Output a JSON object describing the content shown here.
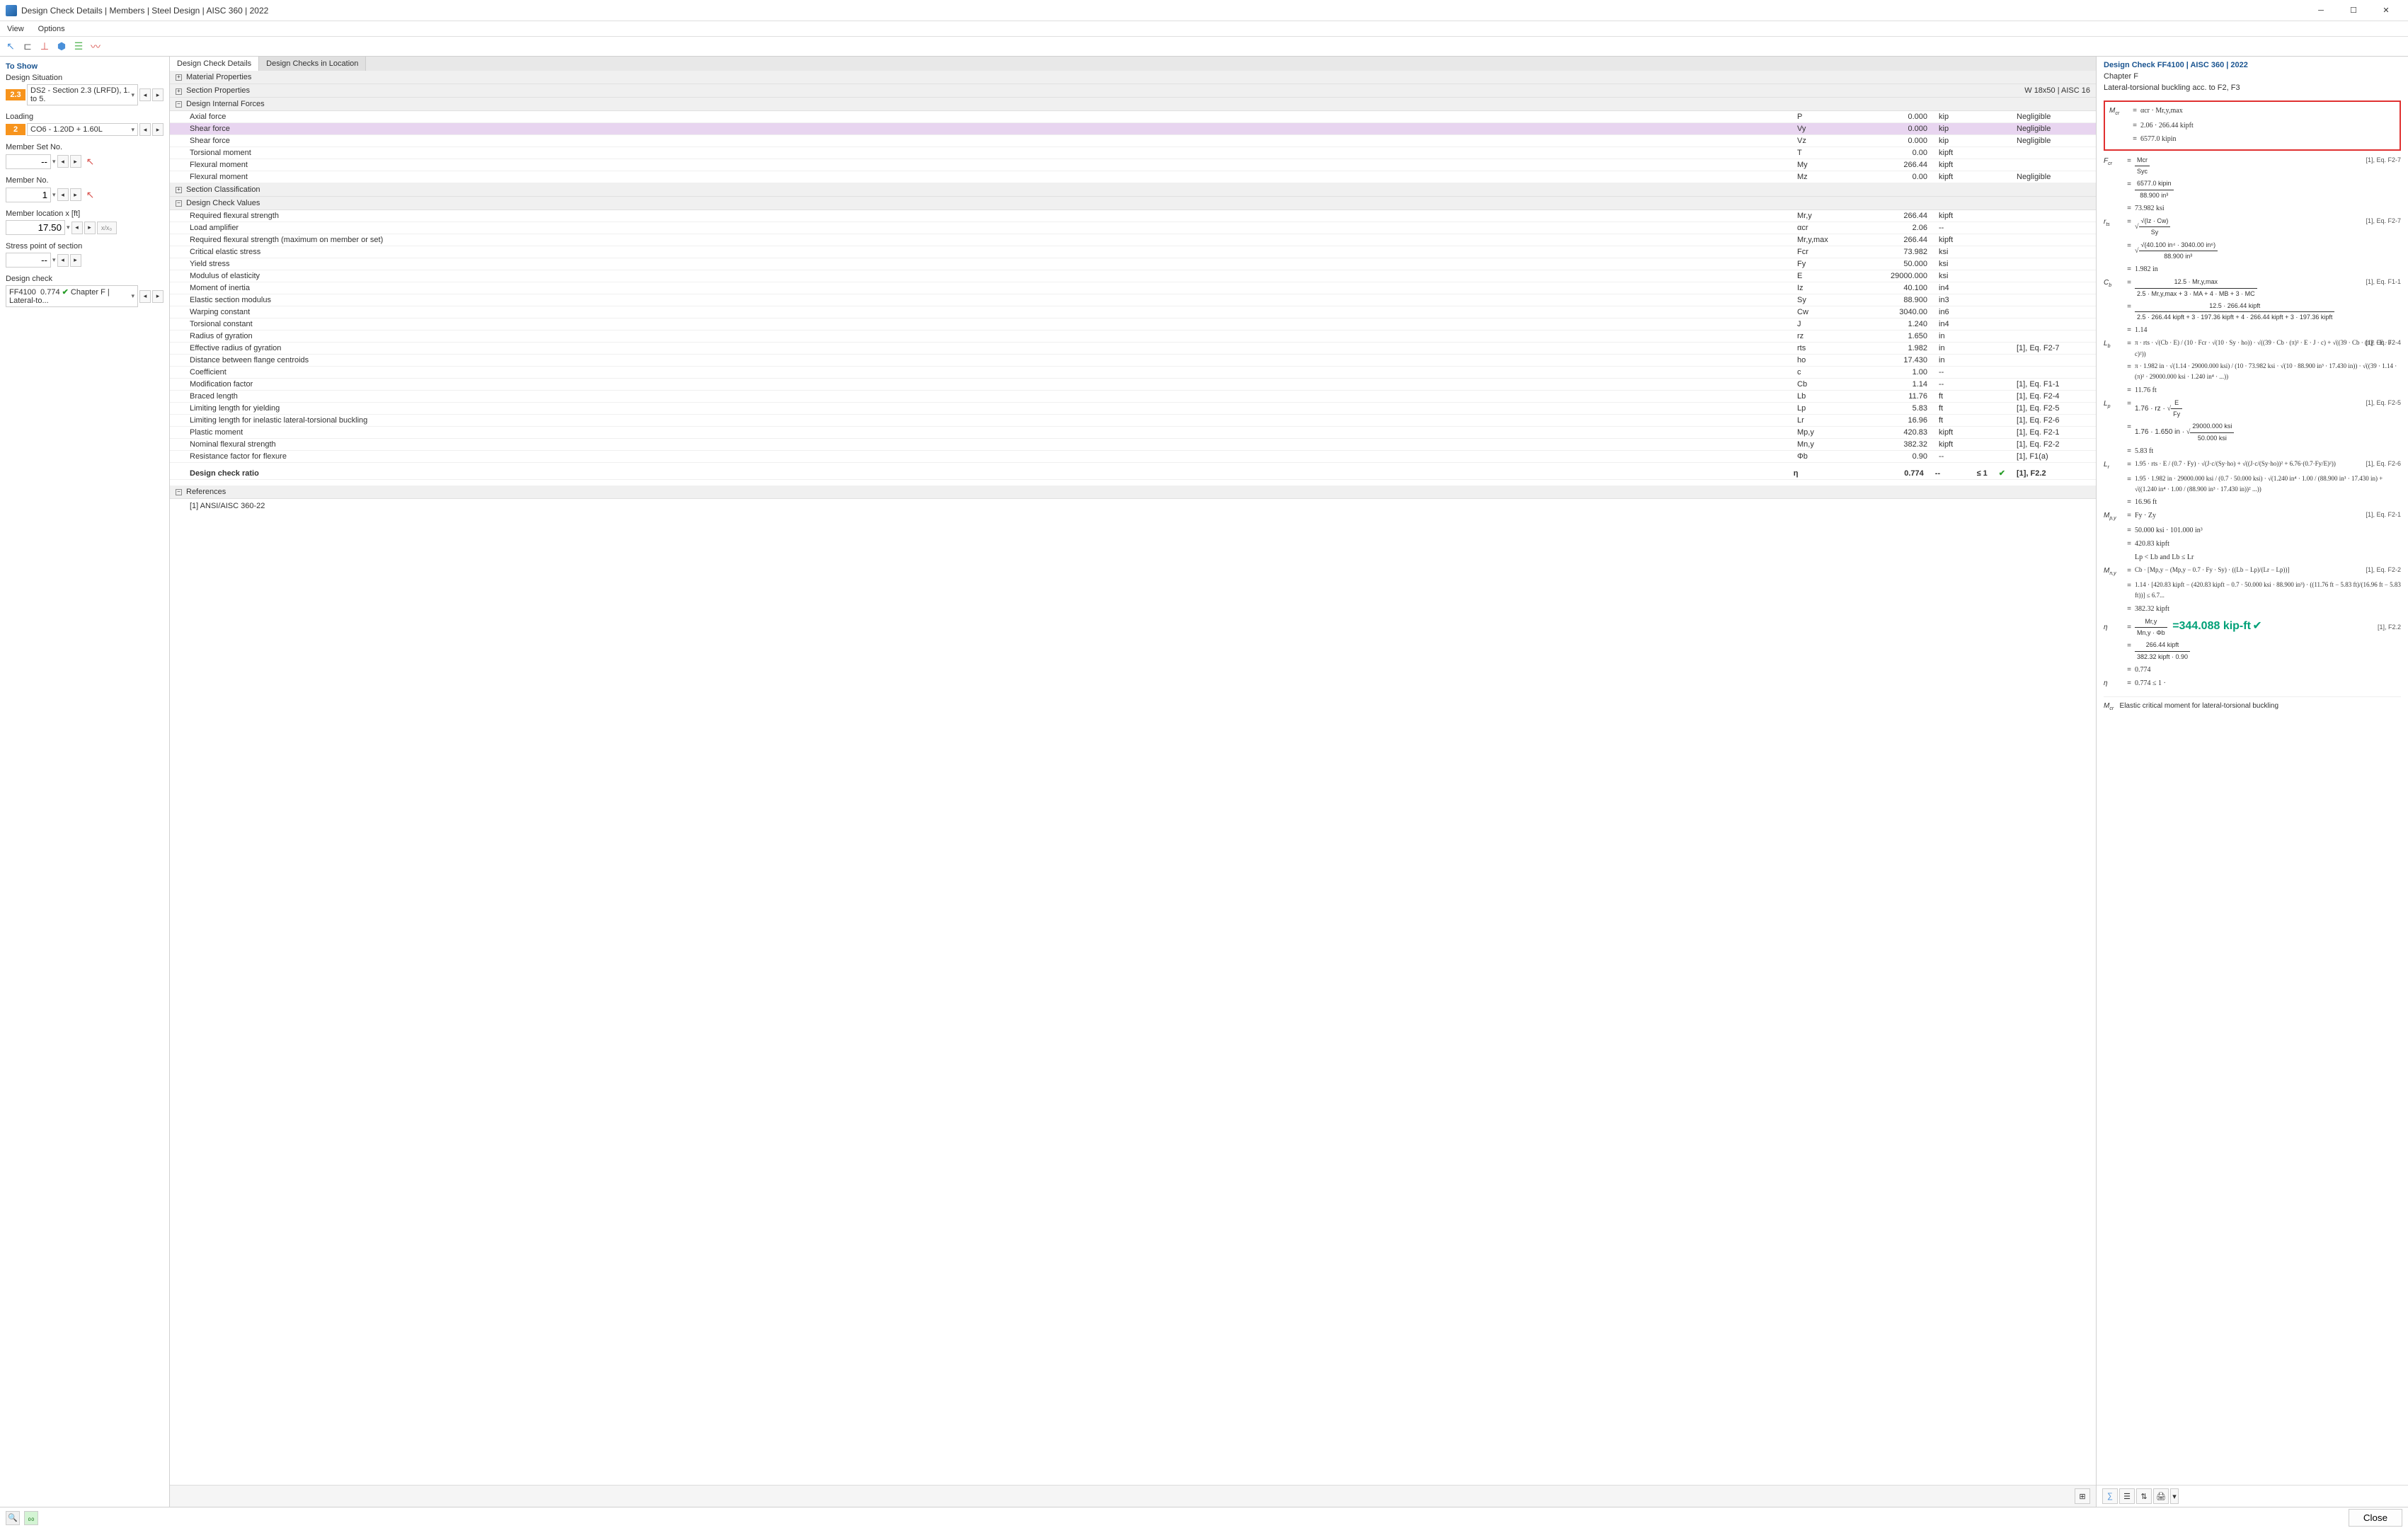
{
  "window": {
    "title": "Design Check Details | Members | Steel Design | AISC 360 | 2022"
  },
  "menu": {
    "view": "View",
    "options": "Options"
  },
  "leftPanel": {
    "header": "To Show",
    "designSituation": {
      "label": "Design Situation",
      "badge": "2.3",
      "value": "DS2 - Section 2.3 (LRFD), 1. to 5."
    },
    "loading": {
      "label": "Loading",
      "badge": "2",
      "value": "CO6 - 1.20D + 1.60L"
    },
    "memberSet": {
      "label": "Member Set No.",
      "value": "--"
    },
    "memberNo": {
      "label": "Member No.",
      "value": "1"
    },
    "memberLocation": {
      "label": "Member location x [ft]",
      "value": "17.50",
      "extra": "x/x₀"
    },
    "stressPoint": {
      "label": "Stress point of section",
      "value": "--"
    },
    "designCheck": {
      "label": "Design check",
      "code": "FF4100",
      "ratio": "0.774",
      "desc": "Chapter F | Lateral-to..."
    }
  },
  "centerPanel": {
    "tabs": {
      "tab1": "Design Check Details",
      "tab2": "Design Checks in Location"
    },
    "sections": {
      "matProps": "Material Properties",
      "sectProps": "Section Properties",
      "sectBadge": "W 18x50 | AISC 16",
      "internalForces": "Design Internal Forces",
      "sectClass": "Section Classification",
      "checkValues": "Design Check Values",
      "references": "References"
    },
    "internalForces": [
      {
        "name": "Axial force",
        "sym": "P",
        "val": "0.000",
        "unit": "kip",
        "ref": "Negligible"
      },
      {
        "name": "Shear force",
        "sym": "Vy",
        "val": "0.000",
        "unit": "kip",
        "ref": "Negligible",
        "hl": true
      },
      {
        "name": "Shear force",
        "sym": "Vz",
        "val": "0.000",
        "unit": "kip",
        "ref": "Negligible"
      },
      {
        "name": "Torsional moment",
        "sym": "T",
        "val": "0.00",
        "unit": "kipft",
        "ref": ""
      },
      {
        "name": "Flexural moment",
        "sym": "My",
        "val": "266.44",
        "unit": "kipft",
        "ref": ""
      },
      {
        "name": "Flexural moment",
        "sym": "Mz",
        "val": "0.00",
        "unit": "kipft",
        "ref": "Negligible"
      }
    ],
    "checkValues": [
      {
        "name": "Required flexural strength",
        "sym": "Mr,y",
        "val": "266.44",
        "unit": "kipft",
        "ref": ""
      },
      {
        "name": "Load amplifier",
        "sym": "αcr",
        "val": "2.06",
        "unit": "--",
        "ref": ""
      },
      {
        "name": "Required flexural strength (maximum on member or set)",
        "sym": "Mr,y,max",
        "val": "266.44",
        "unit": "kipft",
        "ref": ""
      },
      {
        "name": "Critical elastic stress",
        "sym": "Fcr",
        "val": "73.982",
        "unit": "ksi",
        "ref": ""
      },
      {
        "name": "Yield stress",
        "sym": "Fy",
        "val": "50.000",
        "unit": "ksi",
        "ref": ""
      },
      {
        "name": "Modulus of elasticity",
        "sym": "E",
        "val": "29000.000",
        "unit": "ksi",
        "ref": ""
      },
      {
        "name": "Moment of inertia",
        "sym": "Iz",
        "val": "40.100",
        "unit": "in4",
        "ref": ""
      },
      {
        "name": "Elastic section modulus",
        "sym": "Sy",
        "val": "88.900",
        "unit": "in3",
        "ref": ""
      },
      {
        "name": "Warping constant",
        "sym": "Cw",
        "val": "3040.00",
        "unit": "in6",
        "ref": ""
      },
      {
        "name": "Torsional constant",
        "sym": "J",
        "val": "1.240",
        "unit": "in4",
        "ref": ""
      },
      {
        "name": "Radius of gyration",
        "sym": "rz",
        "val": "1.650",
        "unit": "in",
        "ref": ""
      },
      {
        "name": "Effective radius of gyration",
        "sym": "rts",
        "val": "1.982",
        "unit": "in",
        "ref": "[1], Eq. F2-7"
      },
      {
        "name": "Distance between flange centroids",
        "sym": "ho",
        "val": "17.430",
        "unit": "in",
        "ref": ""
      },
      {
        "name": "Coefficient",
        "sym": "c",
        "val": "1.00",
        "unit": "--",
        "ref": ""
      },
      {
        "name": "Modification factor",
        "sym": "Cb",
        "val": "1.14",
        "unit": "--",
        "ref": "[1], Eq. F1-1"
      },
      {
        "name": "Braced length",
        "sym": "Lb",
        "val": "11.76",
        "unit": "ft",
        "ref": "[1], Eq. F2-4"
      },
      {
        "name": "Limiting length for yielding",
        "sym": "Lp",
        "val": "5.83",
        "unit": "ft",
        "ref": "[1], Eq. F2-5"
      },
      {
        "name": "Limiting length for inelastic lateral-torsional buckling",
        "sym": "Lr",
        "val": "16.96",
        "unit": "ft",
        "ref": "[1], Eq. F2-6"
      },
      {
        "name": "Plastic moment",
        "sym": "Mp,y",
        "val": "420.83",
        "unit": "kipft",
        "ref": "[1], Eq. F2-1"
      },
      {
        "name": "Nominal flexural strength",
        "sym": "Mn,y",
        "val": "382.32",
        "unit": "kipft",
        "ref": "[1], Eq. F2-2"
      },
      {
        "name": "Resistance factor for flexure",
        "sym": "Φb",
        "val": "0.90",
        "unit": "--",
        "ref": "[1], F1(a)"
      }
    ],
    "ratio": {
      "name": "Design check ratio",
      "sym": "η",
      "val": "0.774",
      "unit": "--",
      "crit": "≤ 1",
      "ref": "[1], F2.2"
    },
    "refList": "[1] ANSI/AISC 360-22"
  },
  "rightPanel": {
    "title": "Design Check FF4100 | AISC 360 | 2022",
    "subtitle1": "Chapter F",
    "subtitle2": "Lateral-torsional buckling acc. to F2, F3",
    "result": "=344.088 kip-ft",
    "footnote": "Elastic critical moment for lateral-torsional buckling",
    "formulas": {
      "mcr1": "αcr · Mr,y,max",
      "mcr2": "2.06 · 266.44 kipft",
      "mcr3": "6577.0 kipin",
      "fcr_num": "Mcr",
      "fcr_den": "Syc",
      "fcr2_num": "6577.0 kipin",
      "fcr2_den": "88.900 in³",
      "fcr3": "73.982 ksi",
      "rts_num": "√(Iz · Cw)",
      "rts_den": "Sy",
      "rts2_num": "√(40.100 in⁴ · 3040.00 in⁶)",
      "rts2_den": "88.900 in³",
      "rts3": "1.982 in",
      "cb_num": "12.5 · Mr,y,max",
      "cb_den": "2.5 · Mr,y,max + 3 · MA + 4 · MB + 3 · MC",
      "cb2_num": "12.5 · 266.44 kipft",
      "cb2_den": "2.5 · 266.44 kipft + 3 · 197.36 kipft + 4 · 266.44 kipft + 3 · 197.36 kipft",
      "cb3": "1.14",
      "lb1": "π · rts · √(Cb · E) / (10 · Fcr · √(10 · Sy · ho)) · √((39 · Cb · (π)² · E · J · c) + √((39 · Cb · (π)² · E · J · c)²))",
      "lb2": "π · 1.982 in · √(1.14 · 29000.000 ksi) / (10 · 73.982 ksi · √(10 · 88.900 in³ · 17.430 in)) · √((39 · 1.14 · (π)² · 29000.000 ksi · 1.240 in⁴ · ...))",
      "lb3": "11.76 ft",
      "lp1_pre": "1.76 · rz · ",
      "lp1_num": "E",
      "lp1_den": "Fy",
      "lp2_pre": "1.76 · 1.650 in · ",
      "lp2_num": "29000.000 ksi",
      "lp2_den": "50.000 ksi",
      "lp3": "5.83 ft",
      "lr1": "1.95 · rts · E / (0.7 · Fy) · √(J·c/(Sy·ho) + √((J·c/(Sy·ho))² + 6.76·(0.7·Fy/E)²))",
      "lr2": "1.95 · 1.982 in · 29000.000 ksi / (0.7 · 50.000 ksi) · √(1.240 in⁴ · 1.00 / (88.900 in³ · 17.430 in) + √((1.240 in⁴ · 1.00 / (88.900 in³ · 17.430 in))² ...))",
      "lr3": "16.96 ft",
      "mpy1": "Fy · Zy",
      "mpy2": "50.000 ksi · 101.000 in³",
      "mpy3": "420.83 kipft",
      "cond": "Lp < Lb and Lb ≤ Lr",
      "mny1": "Cb · [Mp,y − (Mp,y − 0.7 · Fy · Sy) · ((Lb − Lp)/(Lr − Lp))]",
      "mny2": "1.14 · [420.83 kipft − (420.83 kipft − 0.7 · 50.000 ksi · 88.900 in³) · ((11.76 ft − 5.83 ft)/(16.96 ft − 5.83 ft))] ≤ 6.7...",
      "mny3": "382.32 kipft",
      "eta_num": "Mr,y",
      "eta_den": "Mn,y · Φb",
      "eta2_num": "266.44 kipft",
      "eta2_den": "382.32 kipft · 0.90",
      "eta3": "0.774",
      "eta4": "0.774 ≤ 1 ·"
    },
    "refs": {
      "f27": "[1], Eq. F2-7",
      "f11": "[1], Eq. F1-1",
      "f24": "[1], Eq. F2-4",
      "f25": "[1], Eq. F2-5",
      "f26": "[1], Eq. F2-6",
      "f21": "[1], Eq. F2-1",
      "f22": "[1], Eq. F2-2",
      "f22b": "[1], F2.2"
    }
  },
  "footer": {
    "close": "Close"
  }
}
